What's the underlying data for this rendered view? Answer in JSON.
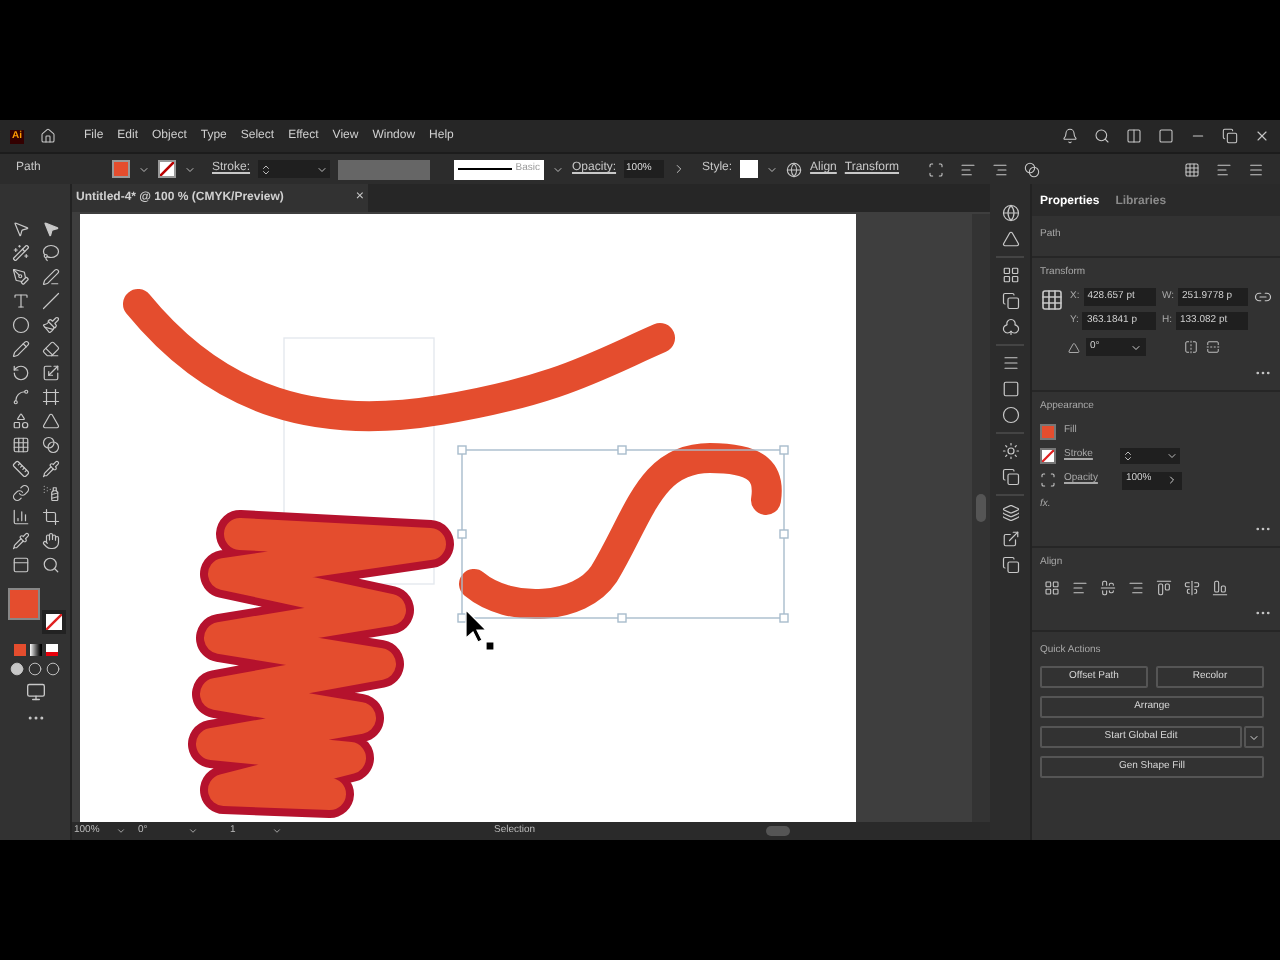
{
  "app_bar": {
    "logo": "Ai",
    "menu": [
      "File",
      "Edit",
      "Object",
      "Type",
      "Select",
      "Effect",
      "View",
      "Window",
      "Help"
    ]
  },
  "control_bar": {
    "selection": "Path",
    "stroke_label": "Stroke:",
    "brush": "Basic",
    "opacity_label": "Opacity:",
    "opacity": "100%",
    "style_label": "Style:",
    "align": "Align",
    "transform": "Transform"
  },
  "document": {
    "tab_title": "Untitled-4* @ 100 % (CMYK/Preview)",
    "close": "×",
    "status_bar": {
      "zoom": "100%",
      "rotation": "0°",
      "artboard": "1",
      "tool": "Selection"
    }
  },
  "properties_panel": {
    "tabs": [
      {
        "label": "Properties",
        "selected": true
      },
      {
        "label": "Libraries",
        "selected": false
      }
    ],
    "object_type": "Path",
    "transform": {
      "title": "Transform",
      "fields": [
        {
          "label": "X:",
          "value": "428.657 pt"
        },
        {
          "label": "W:",
          "value": "251.9778 p"
        },
        {
          "label": "Y:",
          "value": "363.1841 p"
        },
        {
          "label": "H:",
          "value": "133.082 pt"
        }
      ],
      "angle": "0°"
    },
    "appearance": {
      "title": "Appearance",
      "fill": "Fill",
      "stroke": "Stroke",
      "opacity_label": "Opacity",
      "opacity": "100%",
      "effects": "fx."
    },
    "align": {
      "title": "Align"
    },
    "quick_actions": {
      "title": "Quick Actions",
      "buttons": [
        {
          "label": "Offset Path",
          "kind": "half"
        },
        {
          "label": "Recolor",
          "kind": "half"
        },
        {
          "label": "Arrange",
          "kind": "full"
        },
        {
          "label": "Start Global Edit",
          "kind": "split"
        },
        {
          "label": "Gen Shape Fill",
          "kind": "full"
        }
      ]
    }
  }
}
